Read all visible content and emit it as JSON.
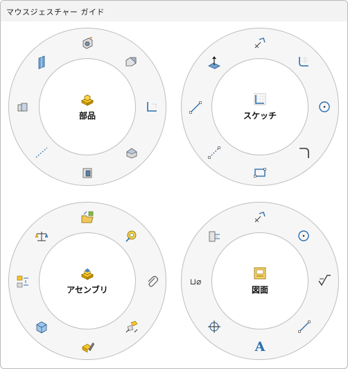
{
  "window": {
    "title": "マウスジェスチャー ガイド"
  },
  "wheels": [
    {
      "id": "part",
      "center": {
        "label": "部品",
        "icon": "part-icon"
      },
      "commands": [
        "hole-wizard-icon",
        "chamfer-icon",
        "fillet-edge-icon",
        "revolve-cut-icon",
        "extruded-cut-icon",
        "centerline-icon",
        "extruded-boss-icon",
        "plane-icon"
      ]
    },
    {
      "id": "sketch",
      "center": {
        "label": "スケッチ",
        "icon": "sketch-icon"
      },
      "commands": [
        "smart-dimension-icon",
        "fillet-corner-icon",
        "circle-icon",
        "sketch-fillet-icon",
        "rectangle-icon",
        "construction-line-icon",
        "line-icon",
        "normal-to-icon"
      ]
    },
    {
      "id": "assembly",
      "center": {
        "label": "アセンブリ",
        "icon": "assembly-icon"
      },
      "commands": [
        "insert-component-icon",
        "measure-icon",
        "paperclip-icon",
        "move-component-icon",
        "edit-component-icon",
        "section-view-icon",
        "explode-view-icon",
        "mass-properties-icon"
      ]
    },
    {
      "id": "drawing",
      "center": {
        "label": "図面",
        "icon": "drawing-icon"
      },
      "commands": [
        "smart-dimension-icon",
        "circle-icon",
        "surface-finish-icon",
        "line-icon",
        "note-icon",
        "center-mark-icon",
        "hole-callout-icon",
        "datum-feature-icon"
      ],
      "hole_callout_text": "⊔⌀",
      "note_text": "A"
    }
  ]
}
